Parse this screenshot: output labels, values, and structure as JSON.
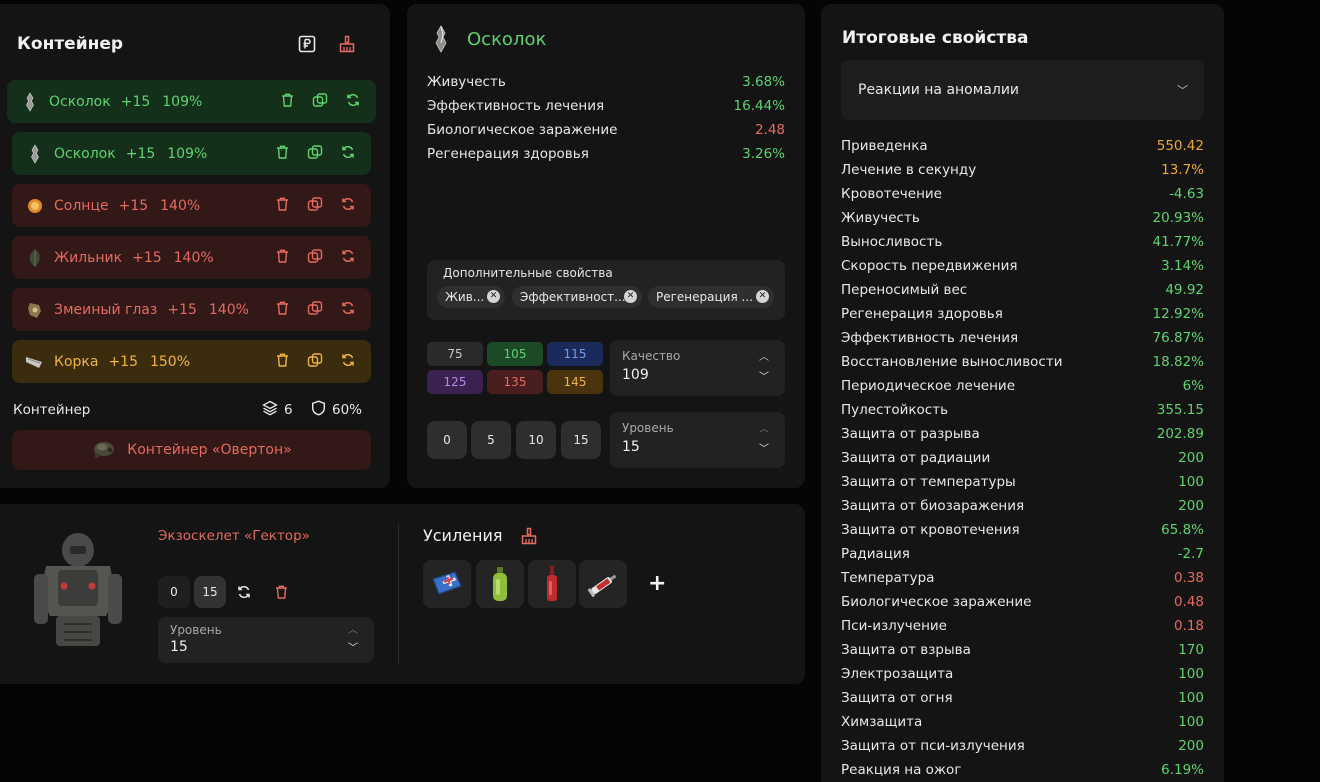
{
  "container_panel": {
    "title": "Контейнер",
    "artifacts": [
      {
        "name": "Осколок",
        "level": "+15",
        "quality": "109%",
        "tone": "green"
      },
      {
        "name": "Осколок",
        "level": "+15",
        "quality": "109%",
        "tone": "green"
      },
      {
        "name": "Солнце",
        "level": "+15",
        "quality": "140%",
        "tone": "red"
      },
      {
        "name": "Жильник",
        "level": "+15",
        "quality": "140%",
        "tone": "red"
      },
      {
        "name": "Змеиный глаз",
        "level": "+15",
        "quality": "140%",
        "tone": "red"
      },
      {
        "name": "Корка",
        "level": "+15",
        "quality": "150%",
        "tone": "gold"
      }
    ],
    "container_label": "Контейнер",
    "slots": "6",
    "protection": "60%",
    "container_name": "Контейнер «Овертон»"
  },
  "artifact_panel": {
    "title": "Осколок",
    "stats": [
      {
        "label": "Живучесть",
        "value": "3.68%",
        "tone": "green"
      },
      {
        "label": "Эффективность лечения",
        "value": "16.44%",
        "tone": "green"
      },
      {
        "label": "Биологическое заражение",
        "value": "2.48",
        "tone": "red"
      },
      {
        "label": "Регенерация здоровья",
        "value": "3.26%",
        "tone": "green"
      }
    ],
    "extra_title": "Дополнительные свойства",
    "extra_chips": [
      "Жив...",
      "Эффективност...",
      "Регенерация ..."
    ],
    "quality_presets": [
      {
        "label": "75",
        "bg": "#2a2a2a",
        "fg": "#c8c8c8"
      },
      {
        "label": "105",
        "bg": "#1d4a26",
        "fg": "#5ed36e"
      },
      {
        "label": "115",
        "bg": "#1b2a5a",
        "fg": "#6f9cf0"
      },
      {
        "label": "125",
        "bg": "#3a2150",
        "fg": "#b58ae8"
      },
      {
        "label": "135",
        "bg": "#4a1e1e",
        "fg": "#e66a5d"
      },
      {
        "label": "145",
        "bg": "#4a3410",
        "fg": "#f0b43c"
      }
    ],
    "quality_label": "Качество",
    "quality_value": "109",
    "level_presets": [
      "0",
      "5",
      "10",
      "15"
    ],
    "level_label": "Уровень",
    "level_value": "15"
  },
  "armor_panel": {
    "name": "Экзоскелет «Гектор»",
    "level_buttons": [
      "0",
      "15"
    ],
    "level_label": "Уровень",
    "level_value": "15",
    "boosts_title": "Усиления",
    "boosts": [
      "medkit-icon",
      "green-bottle-icon",
      "red-bottle-icon",
      "syringe-icon"
    ]
  },
  "summary_panel": {
    "title": "Итоговые свойства",
    "dropdown_value": "Реакции на аномалии",
    "stats": [
      {
        "label": "Приведенка",
        "value": "550.42",
        "tone": "orange"
      },
      {
        "label": "Лечение в секунду",
        "value": "13.7%",
        "tone": "orange"
      },
      {
        "label": "Кровотечение",
        "value": "-4.63",
        "tone": "green"
      },
      {
        "label": "Живучесть",
        "value": "20.93%",
        "tone": "green"
      },
      {
        "label": "Выносливость",
        "value": "41.77%",
        "tone": "green"
      },
      {
        "label": "Скорость передвижения",
        "value": "3.14%",
        "tone": "green"
      },
      {
        "label": "Переносимый вес",
        "value": "49.92",
        "tone": "green"
      },
      {
        "label": "Регенерация здоровья",
        "value": "12.92%",
        "tone": "green"
      },
      {
        "label": "Эффективность лечения",
        "value": "76.87%",
        "tone": "green"
      },
      {
        "label": "Восстановление выносливости",
        "value": "18.82%",
        "tone": "green"
      },
      {
        "label": "Периодическое лечение",
        "value": "6%",
        "tone": "green"
      },
      {
        "label": "Пулестойкость",
        "value": "355.15",
        "tone": "green"
      },
      {
        "label": "Защита от разрыва",
        "value": "202.89",
        "tone": "green"
      },
      {
        "label": "Защита от радиации",
        "value": "200",
        "tone": "green"
      },
      {
        "label": "Защита от температуры",
        "value": "100",
        "tone": "green"
      },
      {
        "label": "Защита от биозаражения",
        "value": "200",
        "tone": "green"
      },
      {
        "label": "Защита от кровотечения",
        "value": "65.8%",
        "tone": "green"
      },
      {
        "label": "Радиация",
        "value": "-2.7",
        "tone": "green"
      },
      {
        "label": "Температура",
        "value": "0.38",
        "tone": "red"
      },
      {
        "label": "Биологическое заражение",
        "value": "0.48",
        "tone": "red"
      },
      {
        "label": "Пси-излучение",
        "value": "0.18",
        "tone": "red"
      },
      {
        "label": "Защита от взрыва",
        "value": "170",
        "tone": "green"
      },
      {
        "label": "Электрозащита",
        "value": "100",
        "tone": "green"
      },
      {
        "label": "Защита от огня",
        "value": "100",
        "tone": "green"
      },
      {
        "label": "Химзащита",
        "value": "100",
        "tone": "green"
      },
      {
        "label": "Защита от пси-излучения",
        "value": "200",
        "tone": "green"
      },
      {
        "label": "Реакция на ожог",
        "value": "6.19%",
        "tone": "green"
      }
    ]
  },
  "colors": {
    "green": "#5ed36e",
    "red": "#e66a5d",
    "orange": "#f0a834",
    "gold": "#f0b43c",
    "panel": "#141414"
  }
}
